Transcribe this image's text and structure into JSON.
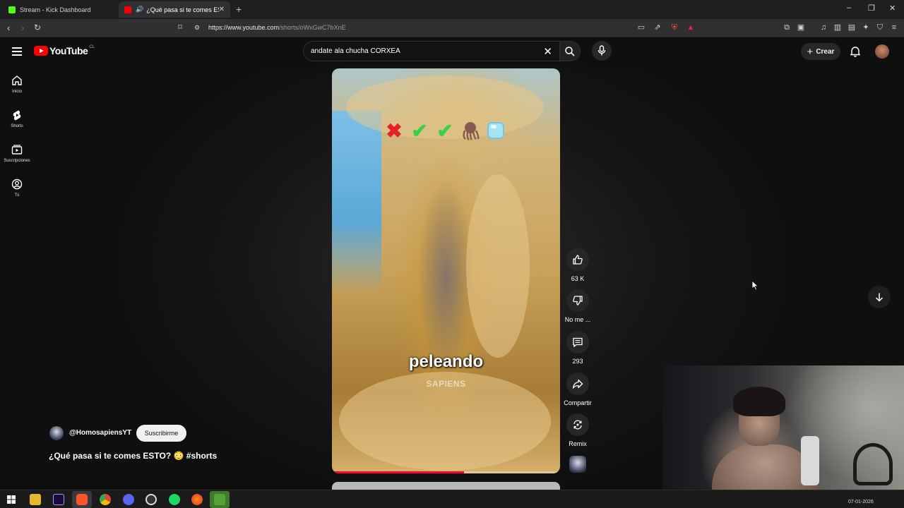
{
  "browser": {
    "tabs": [
      {
        "title": "Stream - Kick Dashboard",
        "active": false,
        "favicon_color": "#53fc18"
      },
      {
        "title": "¿Qué pasa si te comes ESTO?",
        "active": true,
        "favicon_color": "#ff0000"
      }
    ],
    "new_tab": "+",
    "window_controls": {
      "minimize": "–",
      "maximize": "❐",
      "close": "✕"
    },
    "url_host": "https://www.youtube.com",
    "url_path": "/shorts/oWxGwC7bXnE"
  },
  "youtube": {
    "logo_text": "YouTube",
    "country_code": "CL",
    "search_query": "andate ala chucha CORXEA",
    "create_label": "Crear",
    "sidebar": [
      {
        "label": "Inicio",
        "icon": "home-icon"
      },
      {
        "label": "Shorts",
        "icon": "shorts-icon"
      },
      {
        "label": "Suscripciones",
        "icon": "subscriptions-icon"
      },
      {
        "label": "Tú",
        "icon": "you-icon"
      }
    ]
  },
  "short": {
    "caption": "peleando",
    "watermark": "SAPIENS",
    "progress_fraction": 0.58,
    "emojis": [
      "red-x",
      "green-check",
      "green-check",
      "octopus",
      "ice-cube"
    ],
    "actions": [
      {
        "label": "63 K",
        "icon": "like-icon"
      },
      {
        "label": "No me ...",
        "icon": "dislike-icon"
      },
      {
        "label": "293",
        "icon": "comment-icon"
      },
      {
        "label": "Compartir",
        "icon": "share-icon"
      },
      {
        "label": "Remix",
        "icon": "remix-icon"
      }
    ],
    "channel": "@HomosapiensYT",
    "subscribe_label": "Suscribirme",
    "title": "¿Qué pasa si te comes ESTO? 😳 #shorts"
  },
  "taskbar": {
    "date": "07-01-2026"
  },
  "colors": {
    "youtube_red": "#ff0000",
    "progress_red": "#ff0033",
    "background": "#0f0f0f"
  }
}
